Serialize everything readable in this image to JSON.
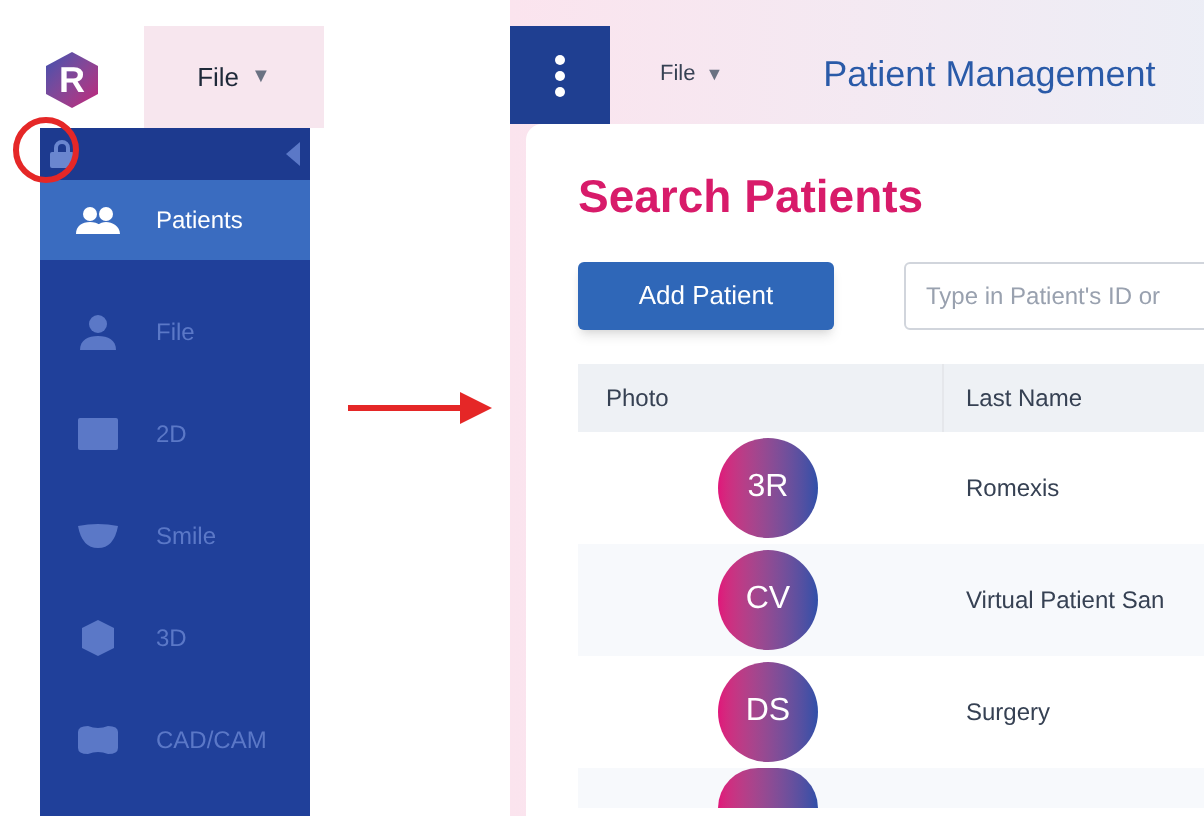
{
  "left_panel": {
    "logo_letter": "R",
    "file_menu": {
      "label": "File",
      "caret": "▼"
    },
    "sidebar": {
      "locked": true,
      "items": [
        {
          "label": "Patients",
          "kind": "people",
          "selected": true
        },
        {
          "label": "File",
          "kind": "person",
          "selected": false
        },
        {
          "label": "2D",
          "kind": "flat",
          "selected": false
        },
        {
          "label": "Smile",
          "kind": "smile",
          "selected": false
        },
        {
          "label": "3D",
          "kind": "cube",
          "selected": false
        },
        {
          "label": "CAD/CAM",
          "kind": "tooth",
          "selected": false
        }
      ]
    }
  },
  "right_panel": {
    "file_menu": {
      "label": "File",
      "caret": "▼"
    },
    "title": "Patient Management",
    "heading": "Search Patients",
    "add_button": "Add Patient",
    "search": {
      "placeholder": "Type in Patient's ID or"
    },
    "table": {
      "columns": [
        "Photo",
        "Last Name"
      ],
      "rows": [
        {
          "initials": "3R",
          "last_name": "Romexis"
        },
        {
          "initials": "CV",
          "last_name": "Virtual Patient San"
        },
        {
          "initials": "DS",
          "last_name": "Surgery"
        }
      ]
    }
  }
}
